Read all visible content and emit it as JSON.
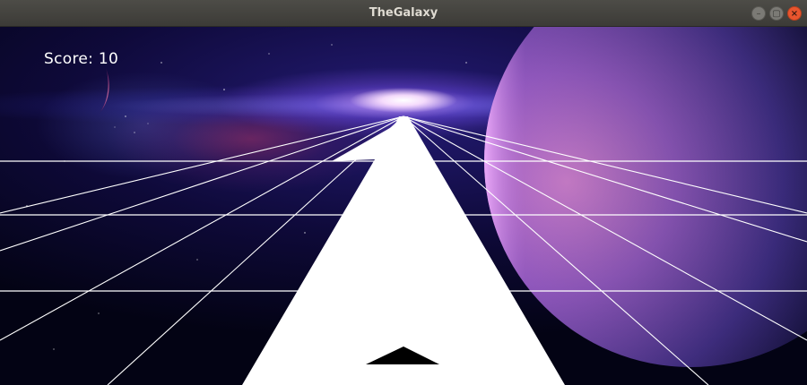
{
  "window": {
    "title": "TheGalaxy",
    "buttons": {
      "minimize": "–",
      "maximize": "▢",
      "close": "×"
    }
  },
  "hud": {
    "score_text": "Score: 10"
  },
  "colors": {
    "grid_line": "#ffffff",
    "track": "#ffffff",
    "ship": "#000000",
    "titlebar": "#3c3b37",
    "close_button": "#e9552e"
  }
}
